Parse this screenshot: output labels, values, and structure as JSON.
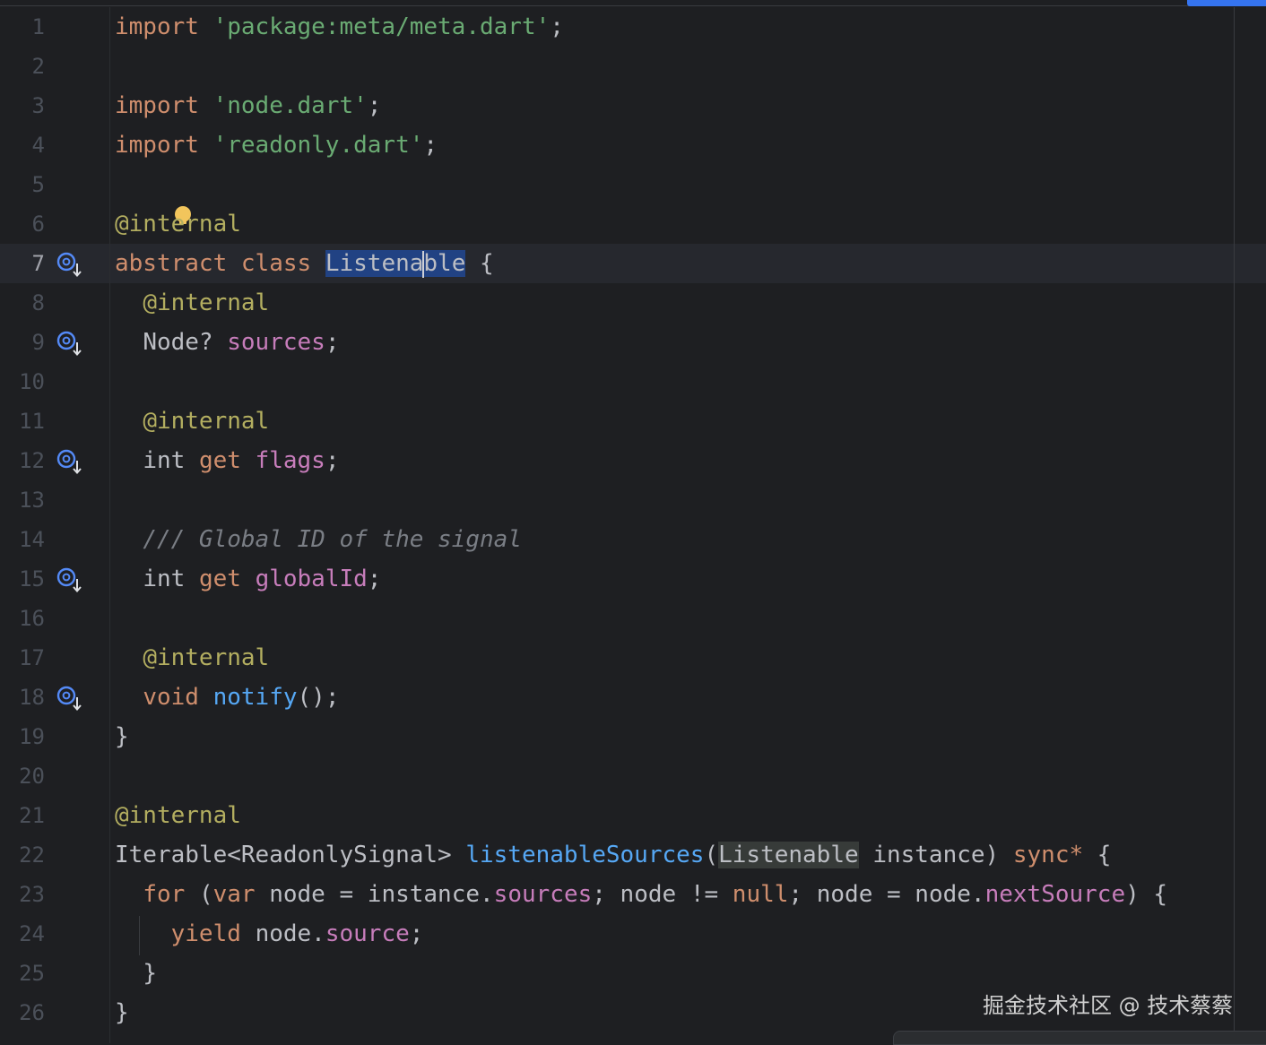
{
  "editor": {
    "line_numbers": [
      "1",
      "2",
      "3",
      "4",
      "5",
      "6",
      "7",
      "8",
      "9",
      "10",
      "11",
      "12",
      "13",
      "14",
      "15",
      "16",
      "17",
      "18",
      "19",
      "20",
      "21",
      "22",
      "23",
      "24",
      "25",
      "26"
    ],
    "current_line": "7",
    "gutter_icon_name": "implemented-in-subclass-icon",
    "gutter_icon_lines": [
      "7",
      "9",
      "12",
      "15",
      "18"
    ],
    "colors": {
      "background": "#1e1f22",
      "keyword": "#cf8e6d",
      "string": "#6aab73",
      "annotation": "#b3ae60",
      "field": "#c77dbb",
      "function": "#56a8f5",
      "comment": "#7a7e85",
      "selection": "#214283"
    },
    "code": {
      "l1": {
        "kw": "import",
        "str": "'package:meta/meta.dart'",
        "end": ";"
      },
      "l3": {
        "kw": "import",
        "str": "'node.dart'",
        "end": ";"
      },
      "l4": {
        "kw": "import",
        "str": "'readonly.dart'",
        "end": ";"
      },
      "l6": {
        "ann_a": "@inte",
        "ann_b": "rnal"
      },
      "l7": {
        "kw1": "abstract",
        "kw2": "class",
        "name_a": "Listena",
        "name_b": "ble",
        "end": "{"
      },
      "l8": {
        "ann": "@internal"
      },
      "l9": {
        "type": "Node?",
        "field": "sources",
        "end": ";"
      },
      "l11": {
        "ann": "@internal"
      },
      "l12": {
        "type": "int",
        "kw": "get",
        "field": "flags",
        "end": ";"
      },
      "l14": {
        "comment": "/// Global ID of the signal"
      },
      "l15": {
        "type": "int",
        "kw": "get",
        "field": "globalId",
        "end": ";"
      },
      "l17": {
        "ann": "@internal"
      },
      "l18": {
        "kw": "void",
        "fn": "notify",
        "end": "();"
      },
      "l19": {
        "brace": "}"
      },
      "l21": {
        "ann": "@internal"
      },
      "l22": {
        "type": "Iterable<ReadonlySignal>",
        "fn": "listenableSources",
        "open": "(",
        "param_type": "Listenable",
        "param": "instance)",
        "kw": "sync*",
        "end": "{"
      },
      "l23": {
        "kw_for": "for",
        "paren": "(",
        "kw_var": "var",
        "text_a": "node = instance.",
        "field_a": "sources",
        "text_b": "; node != ",
        "kw_null": "null",
        "text_c": "; node = node.",
        "field_b": "nextSource",
        "end": ") {"
      },
      "l24": {
        "kw": "yield",
        "text": "node.",
        "field": "source",
        "end": ";"
      },
      "l25": {
        "brace": "}"
      },
      "l26": {
        "brace": "}"
      }
    }
  },
  "watermark": "掘金技术社区 @ 技术蔡蔡"
}
